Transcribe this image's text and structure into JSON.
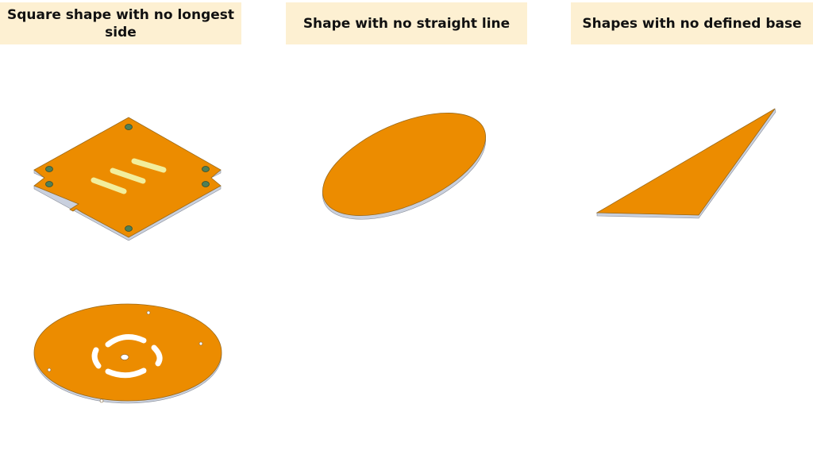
{
  "labels": {
    "square": "Square shape with no longest side",
    "no_straight_line": "Shape with no straight line",
    "no_defined_base": "Shapes with no defined base"
  },
  "colors": {
    "label_background": "#fdf0d2",
    "plate_fill": "#ec8c00",
    "plate_edge": "#c9d0de",
    "plate_outline": "#7a5a2a",
    "hole_green": "#4f7f57",
    "slot_white": "#ffffff"
  }
}
